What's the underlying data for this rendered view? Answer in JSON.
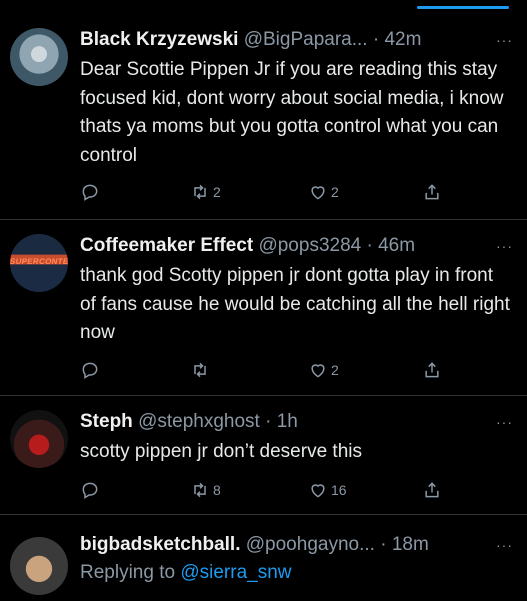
{
  "tweets": [
    {
      "name": "Black Krzyzewski",
      "handle": "@BigPapara...",
      "time": "· 42m",
      "body": "Dear Scottie Pippen Jr if you are reading this stay focused kid, dont worry about social media, i know thats ya moms but you gotta control what you can control",
      "retweets": "2",
      "likes": "2"
    },
    {
      "name": "Coffeemaker Effect",
      "handle": "@pops3284",
      "time": "· 46m",
      "avatar_text": "SUPERCONTEST",
      "body": "thank god Scotty pippen jr dont gotta play in front of fans cause he would be catching all the hell right now",
      "retweets": "",
      "likes": "2"
    },
    {
      "name": "Steph",
      "handle": "@stephxghost",
      "time": "· 1h",
      "body": "scotty pippen jr don’t deserve this",
      "retweets": "8",
      "likes": "16"
    },
    {
      "name": "bigbadsketchball.",
      "handle": "@poohgayno...",
      "time": "· 18m",
      "replying_prefix": "Replying to",
      "replying_to": "@sierra_snw"
    }
  ],
  "more_glyph": "···",
  "icons": {
    "reply": "reply-icon",
    "retweet": "retweet-icon",
    "like": "like-icon",
    "share": "share-icon"
  },
  "colors": {
    "background": "#000000",
    "text": "#e7e9ea",
    "muted": "#8b98a5",
    "accent": "#1d9bf0"
  }
}
